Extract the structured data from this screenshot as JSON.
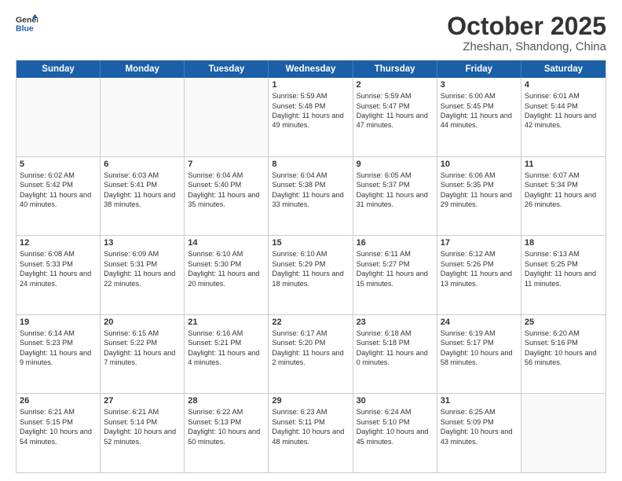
{
  "header": {
    "logo_line1": "General",
    "logo_line2": "Blue",
    "month": "October 2025",
    "location": "Zheshan, Shandong, China"
  },
  "weekdays": [
    "Sunday",
    "Monday",
    "Tuesday",
    "Wednesday",
    "Thursday",
    "Friday",
    "Saturday"
  ],
  "rows": [
    [
      {
        "day": "",
        "info": ""
      },
      {
        "day": "",
        "info": ""
      },
      {
        "day": "",
        "info": ""
      },
      {
        "day": "1",
        "info": "Sunrise: 5:59 AM\nSunset: 5:48 PM\nDaylight: 11 hours and 49 minutes."
      },
      {
        "day": "2",
        "info": "Sunrise: 5:59 AM\nSunset: 5:47 PM\nDaylight: 11 hours and 47 minutes."
      },
      {
        "day": "3",
        "info": "Sunrise: 6:00 AM\nSunset: 5:45 PM\nDaylight: 11 hours and 44 minutes."
      },
      {
        "day": "4",
        "info": "Sunrise: 6:01 AM\nSunset: 5:44 PM\nDaylight: 11 hours and 42 minutes."
      }
    ],
    [
      {
        "day": "5",
        "info": "Sunrise: 6:02 AM\nSunset: 5:42 PM\nDaylight: 11 hours and 40 minutes."
      },
      {
        "day": "6",
        "info": "Sunrise: 6:03 AM\nSunset: 5:41 PM\nDaylight: 11 hours and 38 minutes."
      },
      {
        "day": "7",
        "info": "Sunrise: 6:04 AM\nSunset: 5:40 PM\nDaylight: 11 hours and 35 minutes."
      },
      {
        "day": "8",
        "info": "Sunrise: 6:04 AM\nSunset: 5:38 PM\nDaylight: 11 hours and 33 minutes."
      },
      {
        "day": "9",
        "info": "Sunrise: 6:05 AM\nSunset: 5:37 PM\nDaylight: 11 hours and 31 minutes."
      },
      {
        "day": "10",
        "info": "Sunrise: 6:06 AM\nSunset: 5:35 PM\nDaylight: 11 hours and 29 minutes."
      },
      {
        "day": "11",
        "info": "Sunrise: 6:07 AM\nSunset: 5:34 PM\nDaylight: 11 hours and 26 minutes."
      }
    ],
    [
      {
        "day": "12",
        "info": "Sunrise: 6:08 AM\nSunset: 5:33 PM\nDaylight: 11 hours and 24 minutes."
      },
      {
        "day": "13",
        "info": "Sunrise: 6:09 AM\nSunset: 5:31 PM\nDaylight: 11 hours and 22 minutes."
      },
      {
        "day": "14",
        "info": "Sunrise: 6:10 AM\nSunset: 5:30 PM\nDaylight: 11 hours and 20 minutes."
      },
      {
        "day": "15",
        "info": "Sunrise: 6:10 AM\nSunset: 5:29 PM\nDaylight: 11 hours and 18 minutes."
      },
      {
        "day": "16",
        "info": "Sunrise: 6:11 AM\nSunset: 5:27 PM\nDaylight: 11 hours and 15 minutes."
      },
      {
        "day": "17",
        "info": "Sunrise: 6:12 AM\nSunset: 5:26 PM\nDaylight: 11 hours and 13 minutes."
      },
      {
        "day": "18",
        "info": "Sunrise: 6:13 AM\nSunset: 5:25 PM\nDaylight: 11 hours and 11 minutes."
      }
    ],
    [
      {
        "day": "19",
        "info": "Sunrise: 6:14 AM\nSunset: 5:23 PM\nDaylight: 11 hours and 9 minutes."
      },
      {
        "day": "20",
        "info": "Sunrise: 6:15 AM\nSunset: 5:22 PM\nDaylight: 11 hours and 7 minutes."
      },
      {
        "day": "21",
        "info": "Sunrise: 6:16 AM\nSunset: 5:21 PM\nDaylight: 11 hours and 4 minutes."
      },
      {
        "day": "22",
        "info": "Sunrise: 6:17 AM\nSunset: 5:20 PM\nDaylight: 11 hours and 2 minutes."
      },
      {
        "day": "23",
        "info": "Sunrise: 6:18 AM\nSunset: 5:18 PM\nDaylight: 11 hours and 0 minutes."
      },
      {
        "day": "24",
        "info": "Sunrise: 6:19 AM\nSunset: 5:17 PM\nDaylight: 10 hours and 58 minutes."
      },
      {
        "day": "25",
        "info": "Sunrise: 6:20 AM\nSunset: 5:16 PM\nDaylight: 10 hours and 56 minutes."
      }
    ],
    [
      {
        "day": "26",
        "info": "Sunrise: 6:21 AM\nSunset: 5:15 PM\nDaylight: 10 hours and 54 minutes."
      },
      {
        "day": "27",
        "info": "Sunrise: 6:21 AM\nSunset: 5:14 PM\nDaylight: 10 hours and 52 minutes."
      },
      {
        "day": "28",
        "info": "Sunrise: 6:22 AM\nSunset: 5:13 PM\nDaylight: 10 hours and 50 minutes."
      },
      {
        "day": "29",
        "info": "Sunrise: 6:23 AM\nSunset: 5:11 PM\nDaylight: 10 hours and 48 minutes."
      },
      {
        "day": "30",
        "info": "Sunrise: 6:24 AM\nSunset: 5:10 PM\nDaylight: 10 hours and 45 minutes."
      },
      {
        "day": "31",
        "info": "Sunrise: 6:25 AM\nSunset: 5:09 PM\nDaylight: 10 hours and 43 minutes."
      },
      {
        "day": "",
        "info": ""
      }
    ]
  ]
}
